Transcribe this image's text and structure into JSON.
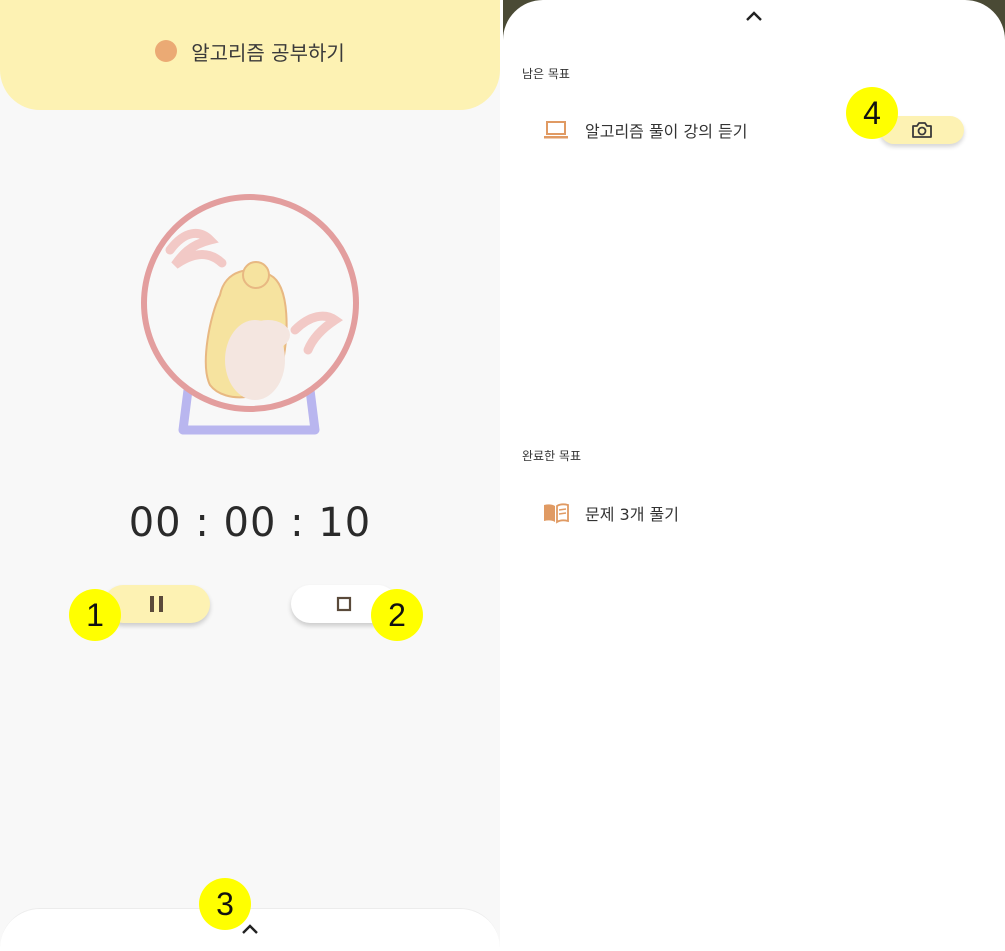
{
  "left": {
    "header": {
      "title": "알고리즘 공부하기",
      "dot_color": "#ebaa74"
    },
    "illustration": "hamster-wheel-icon",
    "timer": "00 : 00 : 10",
    "controls": {
      "pause_icon": "pause-icon",
      "stop_icon": "stop-icon"
    },
    "bottom_sheet": {
      "icon": "chevron-up-icon"
    }
  },
  "right": {
    "sheet": {
      "icon": "chevron-up-icon"
    },
    "remaining": {
      "label": "남은 목표",
      "items": [
        {
          "icon": "laptop-icon",
          "label": "알고리즘 풀이 강의 듣기",
          "action_icon": "camera-icon"
        }
      ]
    },
    "completed": {
      "label": "완료한 목표",
      "items": [
        {
          "icon": "book-icon",
          "label": "문제 3개 풀기"
        }
      ]
    }
  },
  "markers": [
    "1",
    "2",
    "3",
    "4"
  ],
  "colors": {
    "header_bg": "#fdf2b3",
    "accent_orange": "#ebaa74",
    "wheel_pink": "#e39e9e",
    "stand_lavender": "#b9b6ef"
  }
}
